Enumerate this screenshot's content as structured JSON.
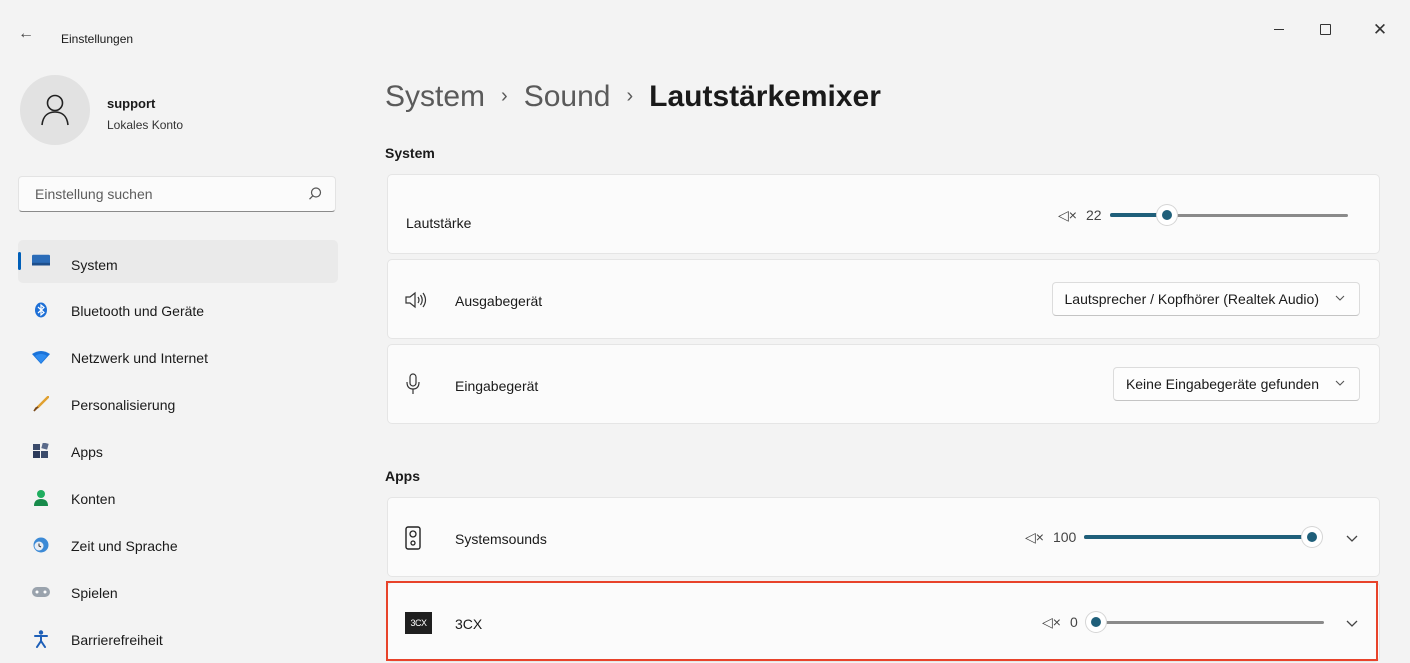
{
  "window": {
    "title": "Einstellungen",
    "back_icon": "back-arrow-icon",
    "controls": [
      "minimize",
      "maximize",
      "close"
    ],
    "close_glyph": "✕"
  },
  "profile": {
    "name": "support",
    "account_type": "Lokales Konto"
  },
  "search": {
    "placeholder": "Einstellung suchen"
  },
  "nav": {
    "items": [
      {
        "label": "System",
        "icon": "monitor-icon",
        "active": true
      },
      {
        "label": "Bluetooth und Geräte",
        "icon": "bluetooth-icon"
      },
      {
        "label": "Netzwerk und Internet",
        "icon": "wifi-icon"
      },
      {
        "label": "Personalisierung",
        "icon": "brush-icon"
      },
      {
        "label": "Apps",
        "icon": "apps-icon"
      },
      {
        "label": "Konten",
        "icon": "person-icon"
      },
      {
        "label": "Zeit und Sprache",
        "icon": "globe-clock-icon"
      },
      {
        "label": "Spielen",
        "icon": "gamepad-icon"
      },
      {
        "label": "Barrierefreiheit",
        "icon": "accessibility-icon"
      }
    ]
  },
  "breadcrumb": {
    "items": [
      "System",
      "Sound",
      "Lautstärkemixer"
    ],
    "separator": "›"
  },
  "system_section": {
    "heading": "System",
    "volume": {
      "label": "Lautstärke",
      "value": "22",
      "level": 0.22,
      "mute_icon": "muted-speaker-icon",
      "mute_glyph": "◁×"
    },
    "output": {
      "label": "Ausgabegerät",
      "value": "Lautsprecher / Kopfhörer (Realtek Audio)",
      "icon": "speaker-icon"
    },
    "input": {
      "label": "Eingabegerät",
      "value": "Keine Eingabegeräte gefunden",
      "icon": "microphone-icon"
    }
  },
  "apps_section": {
    "heading": "Apps",
    "apps": [
      {
        "name": "Systemsounds",
        "value": "100",
        "level": 1.0,
        "icon": "system-speaker-icon"
      },
      {
        "name": "3CX",
        "value": "0",
        "level": 0.0,
        "icon": "3cx-logo-icon",
        "logo_text": "3CX"
      }
    ]
  },
  "colors": {
    "accent": "#005fb8",
    "slider_fill": "#1f5f7a",
    "highlight_border": "#e8432a",
    "background": "#f3f3f3",
    "card": "#fbfbfb"
  }
}
